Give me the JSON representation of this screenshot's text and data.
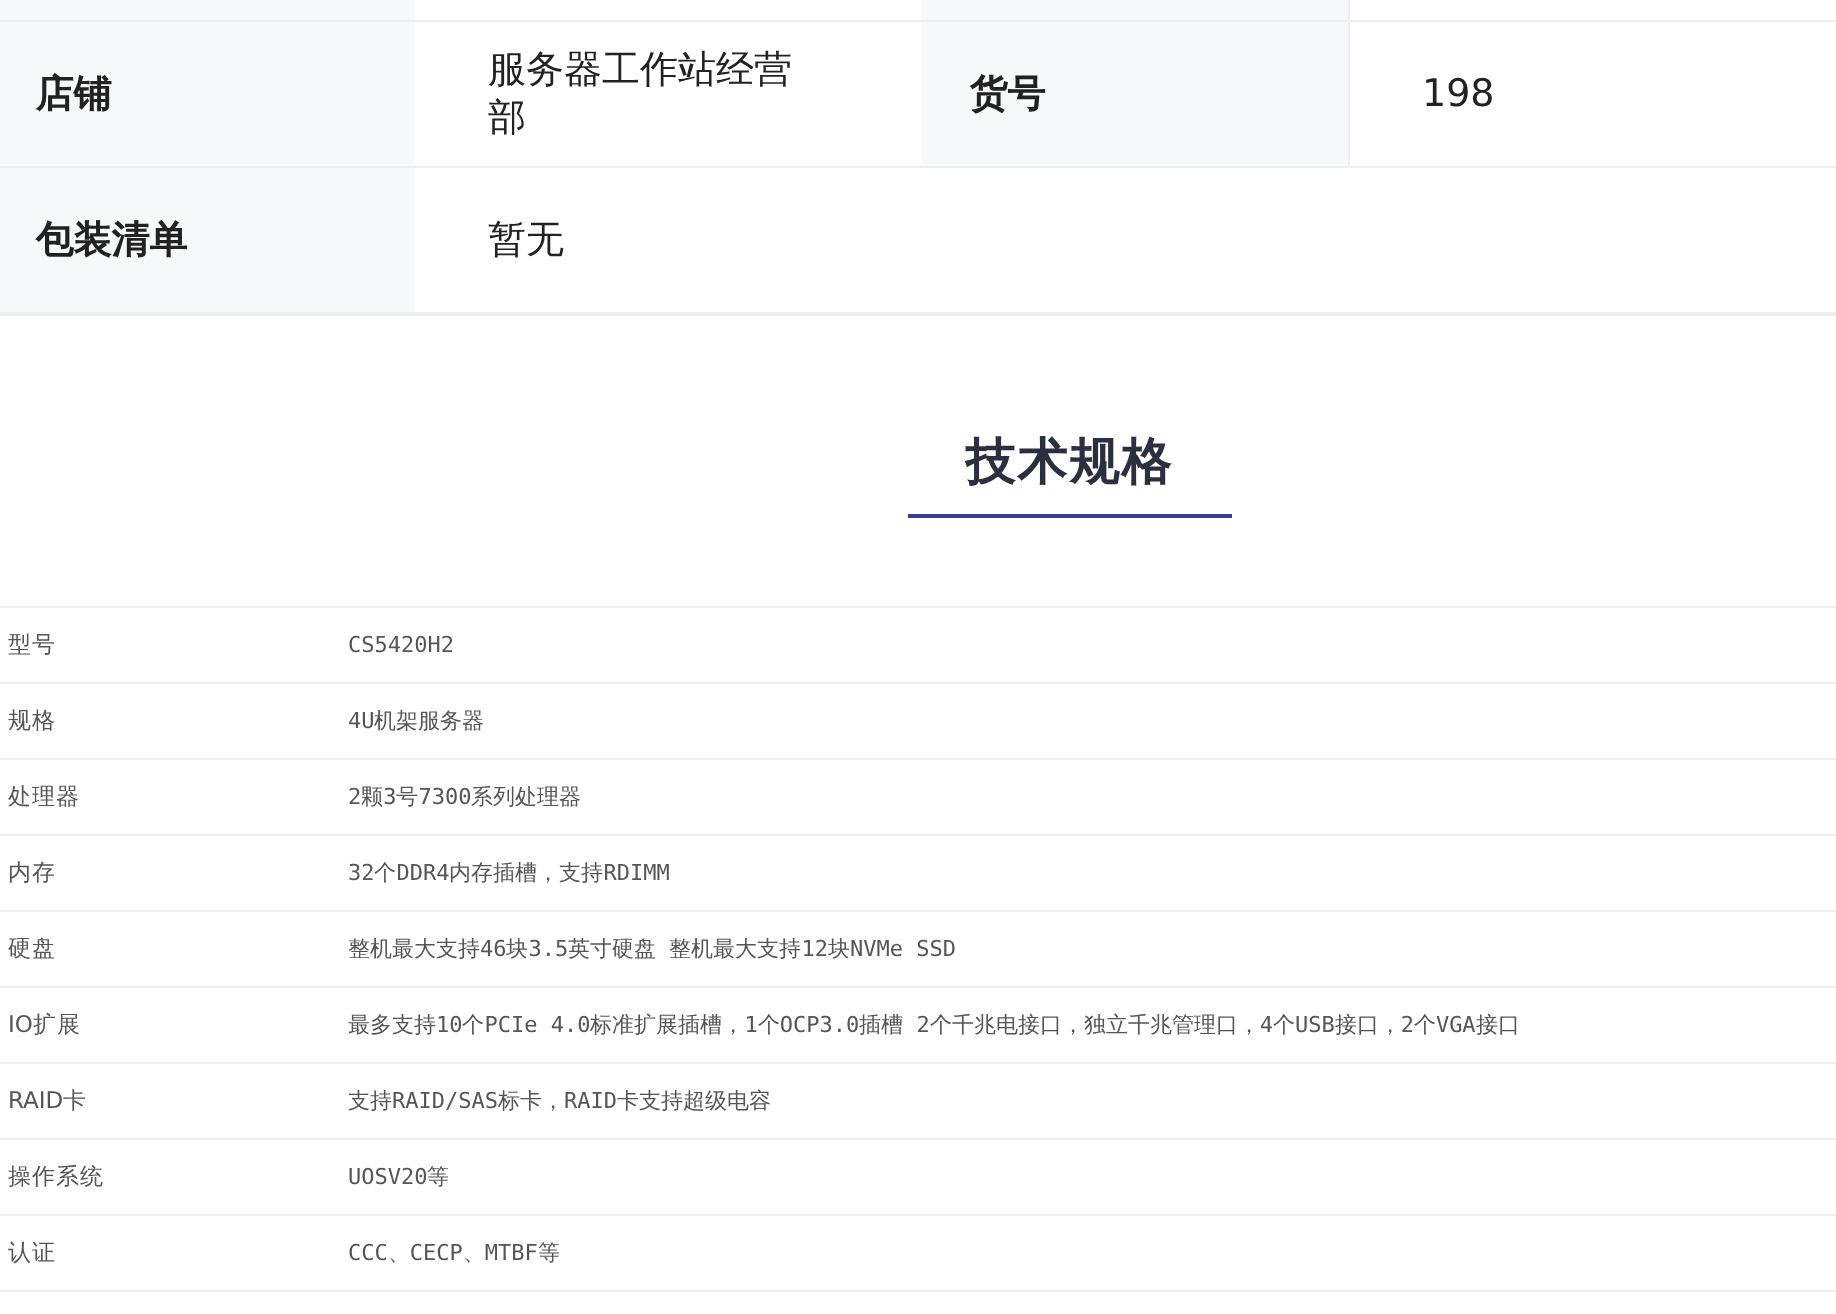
{
  "info_table": {
    "rows": [
      [
        {
          "label": "店铺",
          "value": "服务器工作站经营部"
        },
        {
          "label": "货号",
          "value": "198"
        }
      ],
      [
        {
          "label": "包装清单",
          "value": "暂无"
        }
      ]
    ]
  },
  "spec_section": {
    "title": "技术规格"
  },
  "spec_table": {
    "rows": [
      {
        "name": "型号",
        "value": "CS5420H2"
      },
      {
        "name": "规格",
        "value": "4U机架服务器"
      },
      {
        "name": "处理器",
        "value": "2颗3号7300系列处理器"
      },
      {
        "name": "内存",
        "value": "32个DDR4内存插槽，支持RDIMM"
      },
      {
        "name": "硬盘",
        "value": "整机最大支持46块3.5英寸硬盘 整机最大支持12块NVMe SSD"
      },
      {
        "name": "IO扩展",
        "value": "最多支持10个PCIe 4.0标准扩展插槽，1个OCP3.0插槽 2个千兆电接口，独立千兆管理口，4个USB接口，2个VGA接口"
      },
      {
        "name": "RAID卡",
        "value": "支持RAID/SAS标卡，RAID卡支持超级电容"
      },
      {
        "name": "操作系统",
        "value": "UOSV20等"
      },
      {
        "name": "认证",
        "value": "CCC、CECP、MTBF等"
      }
    ]
  }
}
